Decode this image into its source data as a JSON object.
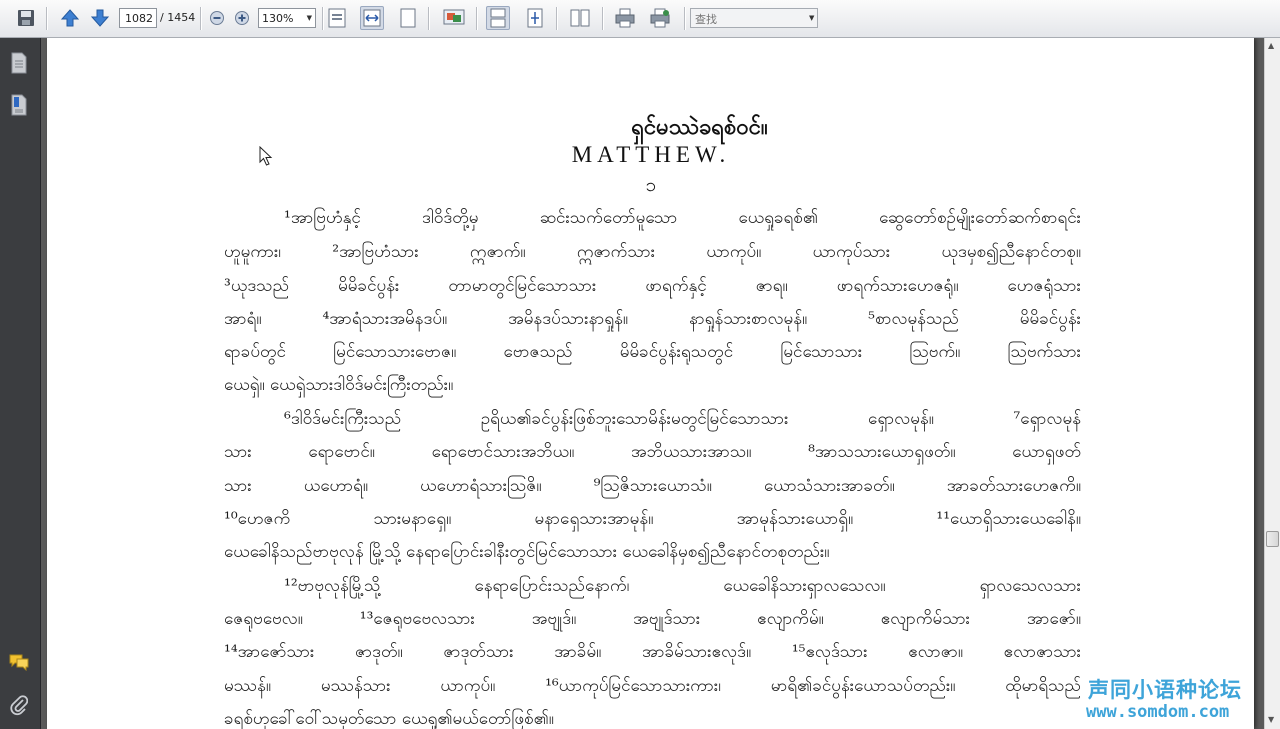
{
  "toolbar": {
    "page_current": "1082",
    "page_total": "/ 1454",
    "zoom": "130%",
    "find_placeholder": "查找",
    "icons": [
      "save-icon",
      "previous-page-icon",
      "next-page-icon",
      "zoom-out-icon",
      "zoom-in-icon",
      "actual-size-icon",
      "fit-width-icon",
      "fit-page-icon",
      "slideshow-icon",
      "single-page-icon",
      "continuous-icon",
      "two-page-icon",
      "print-icon",
      "email-icon",
      "find-dropdown-icon"
    ]
  },
  "leftnav": {
    "icons": [
      "pages-panel-icon",
      "bookmarks-panel-icon",
      "comments-icon",
      "attachments-icon"
    ]
  },
  "document": {
    "title_my": "ရှင်မဿဲခရစ်ဝင်။",
    "title_en": "MATTHEW.",
    "chapter": "၁",
    "lines": [
      "¹အာဗြဟံနှင့် ဒါဝိဒ်တို့မှ ဆင်းသက်တော်မူသော ယေရှုခရစ်၏ ဆွေတော်စဉ်မျိုးတော်ဆက်စာရင်း",
      "ဟူမူကား၊ ²အာဗြဟံသား ဣဇာက်။ ဣဇာက်သား ယာကုပ်။ ယာကုပ်သား ယုဒမှစ၍ညီနောင်တစု။",
      "³ယုဒသည် မိမိခင်ပွန်း တာမာတွင်မြင်သောသား ဖာရက်နှင့် ဇာရ။ ဖာရက်သားဟေဇရုံ။ ဟေဇရုံသား",
      "အာရံ။ ⁴အာရံသားအမိနဒပ်။ အမိနဒပ်သားနာရှုန်။ နာရှုန်သားစာလမုန်။ ⁵စာလမုန်သည် မိမိခင်ပွန်း",
      "ရာခပ်တွင် မြင်သောသားဗောဇ။ ဗောဇသည် မိမိခင်ပွန်းရုသတွင် မြင်သောသား ဩဗက်။ ဩဗက်သား",
      "ယေရှဲ။ ယေရှဲသားဒါဝိဒ်မင်းကြီးတည်း။",
      "⁶ဒါဝိဒ်မင်းကြီးသည် ဥရိယ၏ခင်ပွန်းဖြစ်ဘူးသောမိန်းမတွင်မြင်သောသား ရှောလမုန်။ ⁷ရှောလမုန်",
      "သား ရောဗောင်။ ရောဗောင်သားအဘိယ။ အဘိယသားအာသ။ ⁸အာသသားယောရှဖတ်။ ယောရှဖတ်",
      "သား ယဟောရံ။ ယဟောရံသားဩဇိ။ ⁹ဩဇိသားယောသံ။ ယောသံသားအာခတ်။ အာခတ်သားဟေဇကိ။",
      "¹⁰ဟေဇကိ သားမနာရှေ။ မနာရှေသားအာမုန်။ အာမုန်သားယောရှိ။ ¹¹ယောရှိသားယေခေါနိ။",
      "ယေခေါနိသည်ဗာဗုလုန် မြို့သို့ နေရာပြောင်းခါနီးတွင်မြင်သောသား ယေခေါနိမှစ၍ညီနောင်တစုတည်း။",
      "¹²ဗာဗုလုန်မြို့သို့ နေရာပြောင်းသည်နောက်၊ ယေခေါနိသားရှာလသေလ။ ရှာလသေလသား",
      "ဇေရုဗဗေလ။ ¹³ဇေရုဗဗေလသား အဗျုဒ်။ အဗျုဒ်သား ဧလျာကိမ်။ ဧလျာကိမ်သား အာဇော်။",
      "¹⁴အာဇော်သား ဇာဒုတ်။ ဇာဒုတ်သား အာခိမ်။ အာခိမ်သားဧလုဒ်။ ¹⁵ဧလုဒ်သား ဧလာဇာ။ ဧလာဇာသား",
      "မဿန်။ မဿန်သား ယာကုပ်။ ¹⁶ယာကုပ်မြင်သောသားကား၊ မာရိ၏ခင်ပွန်းယောသပ်တည်း။ ထိုမာရိသည်",
      "ခရစ်ဟုခေါ်ဝေါ်သမုတ်သော ယေရှု၏မယ်တော်ဖြစ်၏။"
    ]
  },
  "watermark": {
    "cn": "声同小语种论坛",
    "url": "www.somdom.com"
  }
}
